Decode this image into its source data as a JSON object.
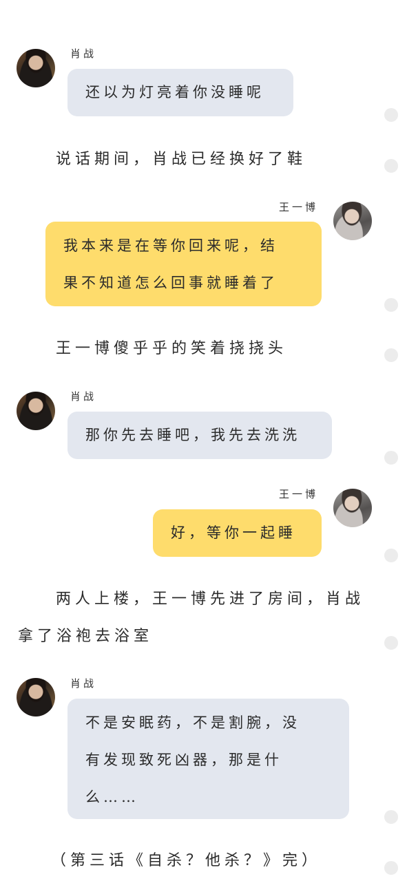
{
  "speakers": {
    "xiao": "肖战",
    "wang": "王一博"
  },
  "messages": {
    "m1": "还以为灯亮着你没睡呢",
    "m2_line1": "我本来是在等你回来呢，结",
    "m2_line2": "果不知道怎么回事就睡着了",
    "m3": "那你先去睡吧，我先去洗洗",
    "m4": "好，等你一起睡",
    "m5_line1": "不是安眠药，不是割腕，没",
    "m5_line2": "有发现致死凶器，那是什",
    "m5_line3": "么……"
  },
  "narration": {
    "n1": "说话期间，肖战已经换好了鞋",
    "n2": "王一博傻乎乎的笑着挠挠头",
    "n3_line1": "两人上楼，王一博先进了房间，肖战",
    "n3_line2": "拿了浴袍去浴室",
    "ending": "（第三话《自杀？他杀？》完）"
  },
  "colors": {
    "gray_bubble": "#e3e7ef",
    "yellow_bubble": "#fedc6c",
    "background": "#ffffff"
  }
}
